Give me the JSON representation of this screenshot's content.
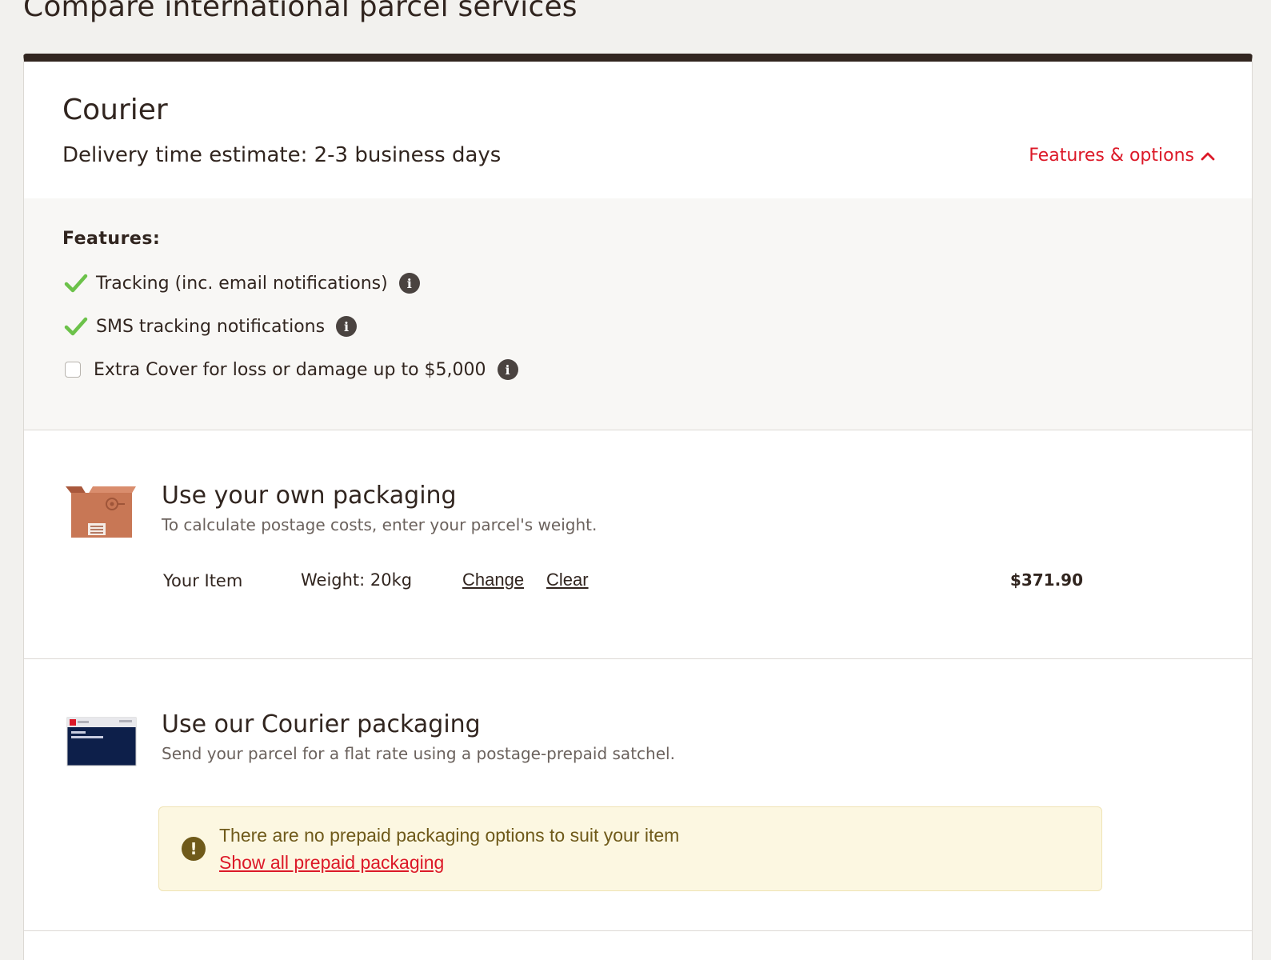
{
  "page": {
    "title": "Compare international parcel services"
  },
  "service": {
    "name": "Courier",
    "delivery_estimate": "Delivery time estimate: 2-3 business days",
    "features_toggle_label": "Features & options"
  },
  "features": {
    "heading": "Features:",
    "items": [
      {
        "label": "Tracking (inc. email notifications)",
        "included": true
      },
      {
        "label": "SMS tracking notifications",
        "included": true
      },
      {
        "label": "Extra Cover for loss or damage up to $5,000",
        "included": false,
        "checked": false
      }
    ]
  },
  "own_packaging": {
    "title": "Use your own packaging",
    "subtitle": "To calculate postage costs, enter your parcel's weight.",
    "item": {
      "name": "Your Item",
      "weight": "Weight: 20kg",
      "change_label": "Change",
      "clear_label": "Clear",
      "price": "$371.90"
    }
  },
  "courier_packaging": {
    "title": "Use our Courier packaging",
    "subtitle": "Send your parcel for a flat rate using a postage-prepaid satchel.",
    "alert": {
      "message": "There are no prepaid packaging options to suit your item",
      "link_label": "Show all prepaid packaging"
    }
  },
  "icons": {
    "check": "check-icon",
    "info": "info-icon",
    "toggle": "chevron-up-icon",
    "alert": "exclamation-icon",
    "box": "cardboard-box-icon",
    "satchel": "courier-satchel-icon"
  },
  "colors": {
    "accent_red": "#dc1928",
    "check_green": "#6cc24a",
    "dark_brown": "#31251f",
    "alert_bg": "#fcf7e1"
  }
}
